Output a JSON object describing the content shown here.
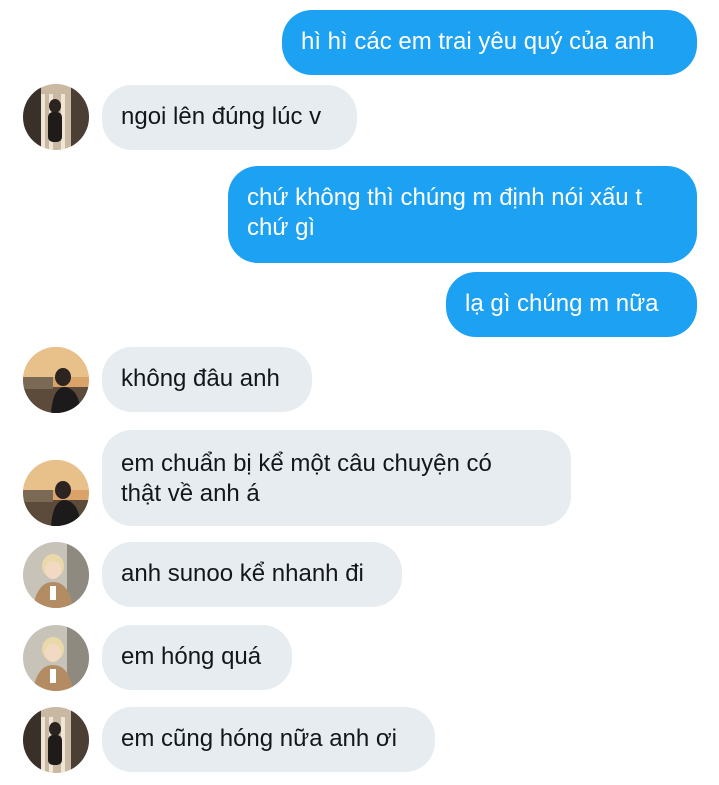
{
  "messages": [
    {
      "from": "me",
      "text": "hì hì các em trai yêu quý của anh"
    },
    {
      "from": "user-a",
      "text": "ngoi lên đúng lúc v"
    },
    {
      "from": "me",
      "text": "chứ không thì chúng m định nói xấu t\nchứ gì"
    },
    {
      "from": "me",
      "text": "lạ gì chúng m nữa"
    },
    {
      "from": "user-b",
      "text": "không đâu anh"
    },
    {
      "from": "user-b",
      "text": "em chuẩn bị kể một câu chuyện có\nthật về anh á"
    },
    {
      "from": "user-c",
      "text": "anh sunoo kể nhanh đi"
    },
    {
      "from": "user-c",
      "text": "em hóng quá"
    },
    {
      "from": "user-a",
      "text": "em cũng hóng nữa anh ơi"
    }
  ],
  "colors": {
    "outgoing_bubble": "#1da1f2",
    "incoming_bubble": "#e6ecf0",
    "outgoing_text": "#ffffff",
    "incoming_text": "#14171a"
  }
}
